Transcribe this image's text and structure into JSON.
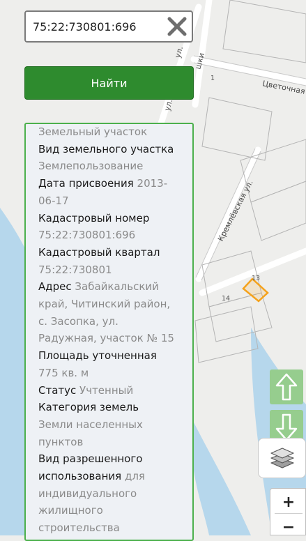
{
  "search": {
    "value": "75:22:730801:696"
  },
  "find_button": {
    "label": "Найти"
  },
  "map": {
    "streets": {
      "tsvetochnaya": "Цветочная",
      "kremlevskaya": "Кремлёвская ул.",
      "ul_left": "ул.",
      "ul_mid": "ул.",
      "shki": "шки"
    },
    "plots": {
      "p1": "1",
      "p13": "13",
      "p14": "14"
    },
    "highlight_color": "#f5a21b",
    "river_color": "#b6d7ec"
  },
  "info": {
    "top_partial": "Земельный участок",
    "land_type_label": "Вид земельного участка",
    "land_type_value": "Землепользование",
    "date_label": "Дата присвоения",
    "date_value_1": "2013-",
    "date_value_2": "06-17",
    "cadastral_number_label": "Кадастровый номер",
    "cadastral_number_value": "75:22:730801:696",
    "cadastral_quarter_label": "Кадастровый квартал",
    "cadastral_quarter_value": "75:22:730801",
    "address_label": "Адрес",
    "address_line1": "Забайкальский",
    "address_line2": "край, Читинский район,",
    "address_line3": "с. Засопка, ул.",
    "address_line4": "Радужная, участок № 15",
    "area_label": "Площадь уточненная",
    "area_value": "775 кв. м",
    "status_label": "Статус",
    "status_value": "Учтенный",
    "category_label": "Категория земель",
    "category_value_1": "Земли населенных",
    "category_value_2": "пунктов",
    "permitted_use_label_1": "Вид разрешенного",
    "permitted_use_label_2": "использования",
    "permitted_use_value_1": "для",
    "permitted_use_value_2": "индивидуального",
    "permitted_use_value_3": "жилищного",
    "permitted_use_value_4": "строительства"
  },
  "controls": {
    "up_arrow_color": "#96cd8e",
    "zoom_in_label": "+",
    "zoom_out_label": "−"
  }
}
